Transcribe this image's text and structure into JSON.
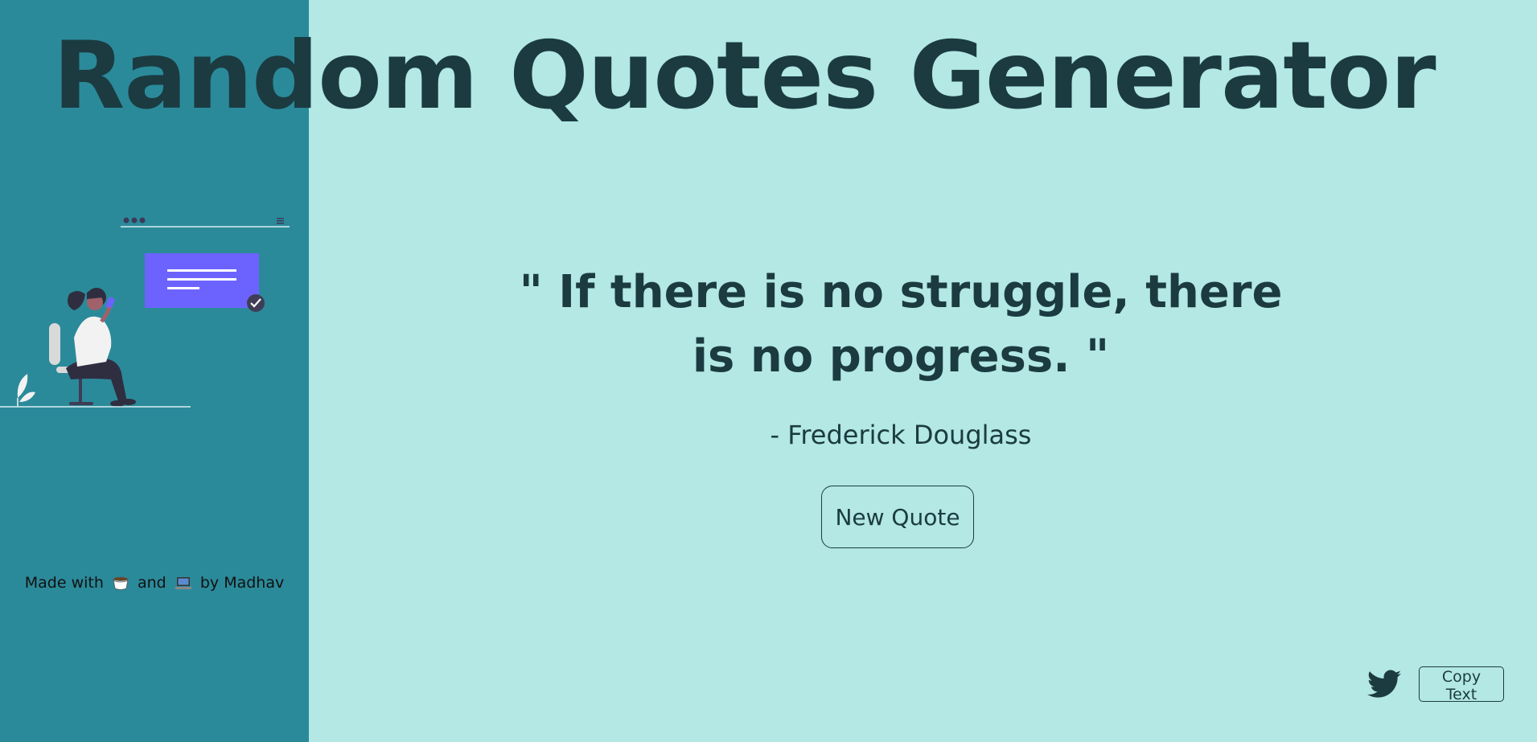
{
  "header": {
    "title": "Random Quotes Generator"
  },
  "sidebar": {
    "credit": {
      "prefix": "Made with",
      "icon_1": "coffee-icon",
      "middle": "and",
      "icon_2": "laptop-icon",
      "suffix": "by Madhav"
    },
    "illustration": "woman-with-phone-illustration"
  },
  "quote": {
    "text": "\" If there is no struggle, there is no progress. \"",
    "author": "- Frederick Douglass"
  },
  "actions": {
    "new_quote_label": "New Quote",
    "copy_label": "Copy Text",
    "share_icon": "twitter-icon"
  },
  "colors": {
    "sidebar_bg": "#2b8a9a",
    "main_bg": "#b3e8e4",
    "text": "#1b3b41",
    "accent": "#6c63ff"
  }
}
